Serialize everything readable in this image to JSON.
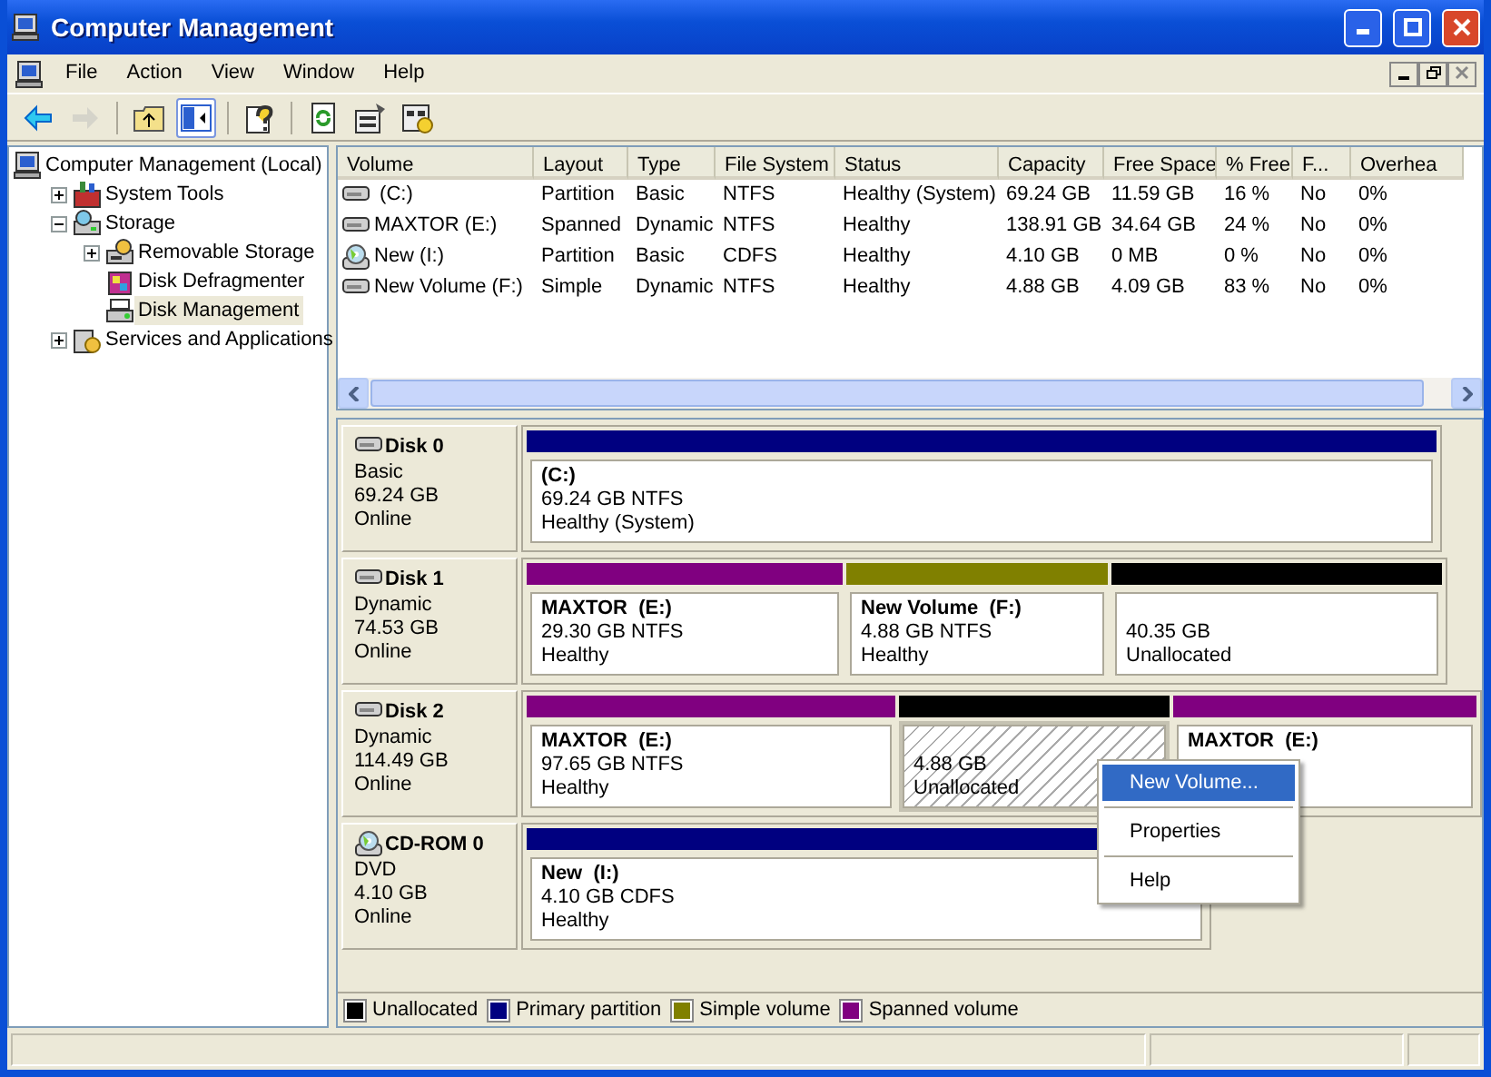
{
  "window": {
    "title": "Computer Management"
  },
  "menu": [
    "File",
    "Action",
    "View",
    "Window",
    "Help"
  ],
  "toolbar": [
    {
      "kind": "back",
      "disabled": false,
      "pressed": false
    },
    {
      "kind": "forward",
      "disabled": true,
      "pressed": false
    },
    {
      "kind": "up",
      "disabled": false,
      "pressed": false
    },
    {
      "kind": "tree",
      "disabled": false,
      "pressed": true
    },
    {
      "kind": "help",
      "disabled": false,
      "pressed": false
    },
    {
      "kind": "refresh",
      "disabled": false,
      "pressed": false
    },
    {
      "kind": "properties",
      "disabled": false,
      "pressed": false
    },
    {
      "kind": "export",
      "disabled": false,
      "pressed": false
    }
  ],
  "tree": [
    {
      "label": "Computer Management (Local)",
      "kind": "computer",
      "selected": false,
      "children": [
        {
          "label": "System Tools",
          "kind": "tools",
          "selected": false,
          "expanded": false
        },
        {
          "label": "Storage",
          "kind": "storage",
          "selected": false,
          "expanded": true,
          "children": [
            {
              "label": "Removable Storage",
              "kind": "removable",
              "selected": false,
              "expanded": false
            },
            {
              "label": "Disk Defragmenter",
              "kind": "defrag",
              "selected": false
            },
            {
              "label": "Disk Management",
              "kind": "diskmgmt",
              "selected": true
            }
          ]
        },
        {
          "label": "Services and Applications",
          "kind": "services",
          "selected": false,
          "expanded": false
        }
      ]
    }
  ],
  "table": {
    "columns": [
      "Volume",
      "Layout",
      "Type",
      "File System",
      "Status",
      "Capacity",
      "Free Space",
      "% Free",
      "F...",
      "Overhea"
    ],
    "rows": [
      {
        "kind": "disk",
        "cells": [
          " (C:)",
          "Partition",
          "Basic",
          "NTFS",
          "Healthy (System)",
          "69.24 GB",
          "11.59 GB",
          "16 %",
          "No",
          "0%"
        ]
      },
      {
        "kind": "disk",
        "cells": [
          "MAXTOR (E:)",
          "Spanned",
          "Dynamic",
          "NTFS",
          "Healthy",
          "138.91 GB",
          "34.64 GB",
          "24 %",
          "No",
          "0%"
        ]
      },
      {
        "kind": "cdrom",
        "cells": [
          "New (I:)",
          "Partition",
          "Basic",
          "CDFS",
          "Healthy",
          "4.10 GB",
          "0 MB",
          "0 %",
          "No",
          "0%"
        ]
      },
      {
        "kind": "disk",
        "cells": [
          "New Volume (F:)",
          "Simple",
          "Dynamic",
          "NTFS",
          "Healthy",
          "4.88 GB",
          "4.09 GB",
          "83 %",
          "No",
          "0%"
        ]
      }
    ]
  },
  "disks": [
    {
      "kind": "disk",
      "name": "Disk 0",
      "type": "Basic",
      "size": "69.24 GB",
      "status": "Online",
      "partitions": [
        {
          "kind": "primary",
          "selected": false,
          "name": "(C:)",
          "size": "69.24 GB NTFS",
          "status": "Healthy (System)"
        }
      ]
    },
    {
      "kind": "disk",
      "name": "Disk 1",
      "type": "Dynamic",
      "size": "74.53 GB",
      "status": "Online",
      "partitions": [
        {
          "kind": "spanned",
          "selected": false,
          "name": "MAXTOR  (E:)",
          "size": "29.30 GB NTFS",
          "status": "Healthy"
        },
        {
          "kind": "simple",
          "selected": false,
          "name": "New Volume  (F:)",
          "size": "4.88 GB NTFS",
          "status": "Healthy"
        },
        {
          "kind": "unallocated",
          "selected": false,
          "size": "40.35 GB",
          "status": "Unallocated"
        }
      ]
    },
    {
      "kind": "disk",
      "name": "Disk 2",
      "type": "Dynamic",
      "size": "114.49 GB",
      "status": "Online",
      "partitions": [
        {
          "kind": "spanned",
          "selected": false,
          "name": "MAXTOR  (E:)",
          "size": "97.65 GB NTFS",
          "status": "Healthy"
        },
        {
          "kind": "unallocated",
          "selected": true,
          "size": "4.88 GB",
          "status": "Unallocated"
        },
        {
          "kind": "spanned",
          "selected": false,
          "name": "MAXTOR  (E:)"
        }
      ]
    },
    {
      "kind": "cdrom",
      "name": "CD-ROM 0",
      "type": "DVD",
      "size": "4.10 GB",
      "status": "Online",
      "partitions": [
        {
          "kind": "primary",
          "selected": false,
          "name": "New  (I:)",
          "size": "4.10 GB CDFS",
          "status": "Healthy"
        }
      ]
    }
  ],
  "legend": [
    {
      "label": "Unallocated",
      "color": "#000000"
    },
    {
      "label": "Primary partition",
      "color": "#000080"
    },
    {
      "label": "Simple volume",
      "color": "#808000"
    },
    {
      "label": "Spanned volume",
      "color": "#800080"
    }
  ],
  "context_menu": [
    {
      "label": "New Volume...",
      "selected": true
    },
    {
      "label": "Properties",
      "selected": false
    },
    {
      "label": "Help",
      "selected": false
    }
  ]
}
